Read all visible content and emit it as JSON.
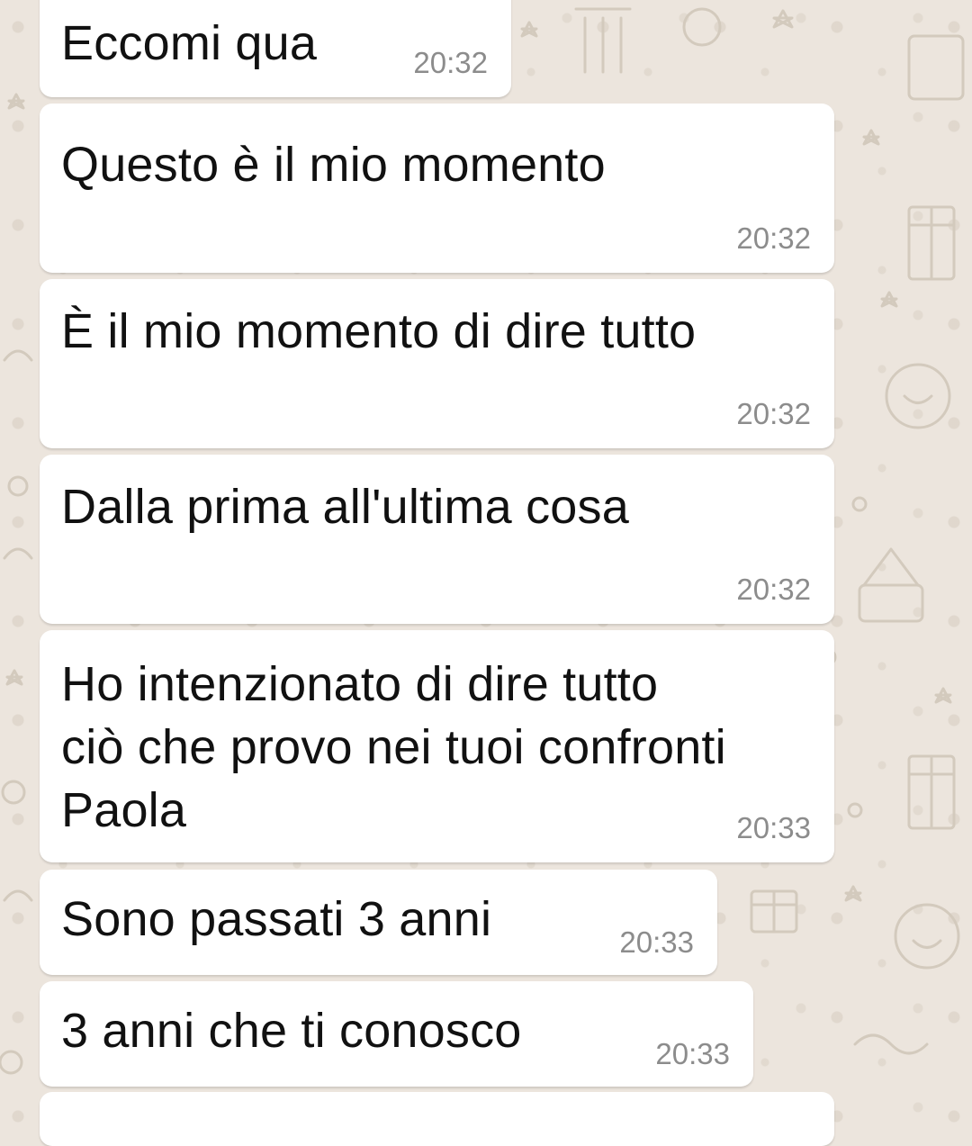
{
  "conversation": {
    "messages": [
      {
        "text": "Eccomi qua",
        "time": "20:32"
      },
      {
        "text": "Questo è il mio momento",
        "time": "20:32"
      },
      {
        "text": "È il mio momento di dire tutto",
        "time": "20:32"
      },
      {
        "text": "Dalla prima all'ultima cosa",
        "time": "20:32"
      },
      {
        "text": "Ho intenzionato di dire tutto\nciò che provo nei tuoi confronti\nPaola",
        "time": "20:33"
      },
      {
        "text": "Sono passati 3 anni",
        "time": "20:33"
      },
      {
        "text": "3 anni che ti conosco",
        "time": "20:33"
      }
    ]
  },
  "colors": {
    "background": "#ece5dd",
    "bubble": "#ffffff",
    "message_text": "#111111",
    "timestamp": "#8c8c8c"
  }
}
